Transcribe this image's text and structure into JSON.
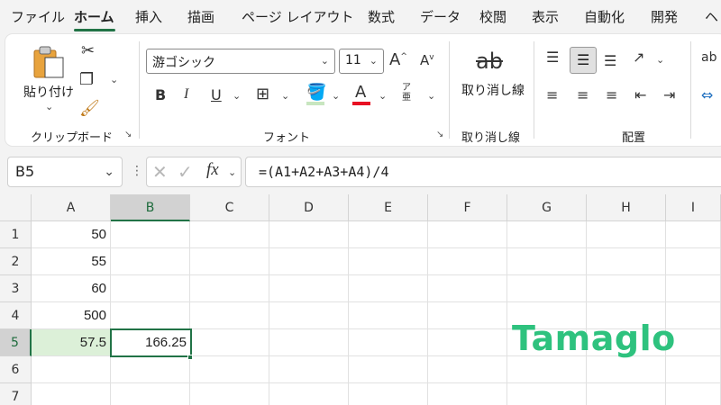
{
  "menu": {
    "items": [
      "ファイル",
      "ホーム",
      "挿入",
      "描画",
      "ページ レイアウト",
      "数式",
      "データ",
      "校閲",
      "表示",
      "自動化",
      "開発",
      "ヘ"
    ],
    "active_index": 1
  },
  "ribbon": {
    "clipboard": {
      "paste_label": "貼り付け",
      "group_label": "クリップボード"
    },
    "font": {
      "font_name": "游ゴシック",
      "font_size": "11",
      "group_label": "フォント"
    },
    "strike": {
      "button_label": "取り消し線",
      "group_label": "取り消し線"
    },
    "alignment": {
      "group_label": "配置"
    }
  },
  "formula_bar": {
    "name_box": "B5",
    "formula": "=(A1+A2+A3+A4)/4",
    "fx_label": "fx"
  },
  "grid": {
    "columns": [
      "A",
      "B",
      "C",
      "D",
      "E",
      "F",
      "G",
      "H",
      "I"
    ],
    "selected_column": "B",
    "rows": [
      "1",
      "2",
      "3",
      "4",
      "5",
      "6",
      "7"
    ],
    "selected_row": "5",
    "cells": {
      "A1": "50",
      "A2": "55",
      "A3": "60",
      "A4": "500",
      "A5": "57.5",
      "B5": "166.25"
    },
    "active_cell": "B5"
  },
  "watermark": {
    "text": "Tamaglo"
  },
  "colors": {
    "accent": "#217346",
    "highlight": "#dcf0d8",
    "watermark": "#2ec27e"
  }
}
